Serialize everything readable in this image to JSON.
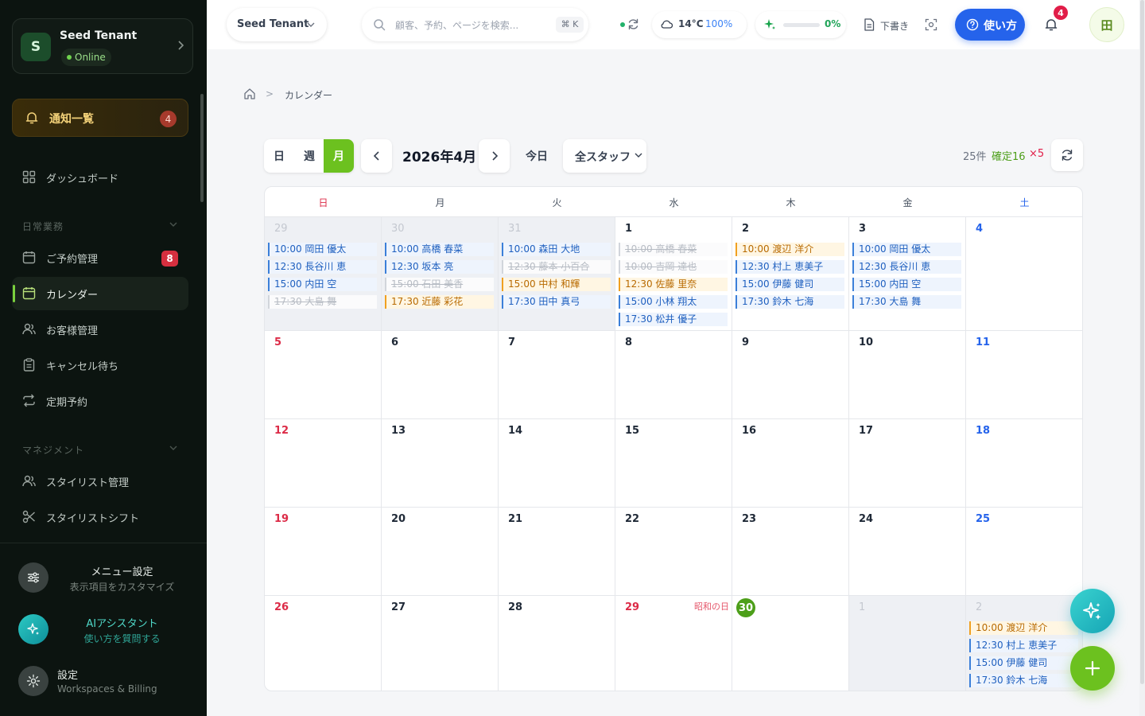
{
  "sidebar": {
    "tenant": {
      "initial": "S",
      "name": "Seed Tenant",
      "status": "Online"
    },
    "notifications": {
      "label": "通知一覧",
      "count": "4"
    },
    "items": [
      {
        "label": "ダッシュボード",
        "icon": "dashboard-icon"
      },
      {
        "label": "ご予約管理",
        "icon": "calendar-icon",
        "badge": "8"
      },
      {
        "label": "カレンダー",
        "icon": "calendar-icon",
        "active": true
      },
      {
        "label": "お客様管理",
        "icon": "users-icon"
      },
      {
        "label": "キャンセル待ち",
        "icon": "clipboard-icon"
      },
      {
        "label": "定期予約",
        "icon": "repeat-icon"
      },
      {
        "label": "スタイリスト管理",
        "icon": "users-icon"
      },
      {
        "label": "スタイリストシフト",
        "icon": "scissors-icon"
      }
    ],
    "sections": [
      "日常業務",
      "マネジメント"
    ],
    "bottom": [
      {
        "title": "メニュー設定",
        "subtitle": "表示項目をカスタマイズ"
      },
      {
        "title": "AIアシスタント",
        "subtitle": "使い方を質問する"
      },
      {
        "title": "設定",
        "subtitle": "Workspaces & Billing"
      }
    ]
  },
  "header": {
    "tenant_select": "Seed Tenant",
    "search_placeholder": "顧客、予約、ページを検索...",
    "search_shortcut": "⌘ K",
    "weather": {
      "temp": "14°C",
      "humidity": "100%"
    },
    "progress": {
      "value": 0,
      "label": "0%"
    },
    "draft_label": "下書き",
    "howto_label": "使い方",
    "notification_count": "4",
    "user_initial": "田"
  },
  "breadcrumb": {
    "current": "カレンダー",
    "separator": ">"
  },
  "toolbar": {
    "views": [
      "日",
      "週",
      "月"
    ],
    "active_view": "月",
    "month_title": "2026年4月",
    "today_label": "今日",
    "staff_filter": "全スタッフ",
    "total_count": "25件",
    "confirmed_count": "確定16",
    "cancel_count": "×5"
  },
  "calendar": {
    "weekdays": [
      "日",
      "月",
      "火",
      "水",
      "木",
      "金",
      "土"
    ],
    "weeks": [
      [
        {
          "day": "29",
          "other": true,
          "events": [
            {
              "text": "10:00 岡田 優太",
              "status": "confirmed"
            },
            {
              "text": "12:30 長谷川 恵",
              "status": "confirmed"
            },
            {
              "text": "15:00 内田 空",
              "status": "confirmed"
            },
            {
              "text": "17:30 大島 舞",
              "status": "cancelled"
            }
          ]
        },
        {
          "day": "30",
          "other": true,
          "events": [
            {
              "text": "10:00 高橋 春菜",
              "status": "confirmed"
            },
            {
              "text": "12:30 坂本 亮",
              "status": "confirmed"
            },
            {
              "text": "15:00 石田 美香",
              "status": "cancelled"
            },
            {
              "text": "17:30 近藤 彩花",
              "status": "pending"
            }
          ]
        },
        {
          "day": "31",
          "other": true,
          "events": [
            {
              "text": "10:00 森田 大地",
              "status": "confirmed"
            },
            {
              "text": "12:30 藤本 小百合",
              "status": "cancelled"
            },
            {
              "text": "15:00 中村 和輝",
              "status": "pending"
            },
            {
              "text": "17:30 田中 真弓",
              "status": "confirmed"
            }
          ]
        },
        {
          "day": "1",
          "events": [
            {
              "text": "10:00 高橋 春菜",
              "status": "cancelled"
            },
            {
              "text": "10:00 吉岡 達也",
              "status": "cancelled"
            },
            {
              "text": "12:30 佐藤 里奈",
              "status": "pending"
            },
            {
              "text": "15:00 小林 翔太",
              "status": "confirmed"
            },
            {
              "text": "17:30 松井 優子",
              "status": "confirmed"
            }
          ]
        },
        {
          "day": "2",
          "events": [
            {
              "text": "10:00 渡辺 洋介",
              "status": "pending"
            },
            {
              "text": "12:30 村上 恵美子",
              "status": "confirmed"
            },
            {
              "text": "15:00 伊藤 健司",
              "status": "confirmed"
            },
            {
              "text": "17:30 鈴木 七海",
              "status": "confirmed"
            }
          ]
        },
        {
          "day": "3",
          "events": [
            {
              "text": "10:00 岡田 優太",
              "status": "confirmed"
            },
            {
              "text": "12:30 長谷川 恵",
              "status": "confirmed"
            },
            {
              "text": "15:00 内田 空",
              "status": "confirmed"
            },
            {
              "text": "17:30 大島 舞",
              "status": "confirmed"
            }
          ]
        },
        {
          "day": "4",
          "events": []
        }
      ],
      [
        {
          "day": "5",
          "events": []
        },
        {
          "day": "6",
          "events": []
        },
        {
          "day": "7",
          "events": []
        },
        {
          "day": "8",
          "events": []
        },
        {
          "day": "9",
          "events": []
        },
        {
          "day": "10",
          "events": []
        },
        {
          "day": "11",
          "events": []
        }
      ],
      [
        {
          "day": "12",
          "events": []
        },
        {
          "day": "13",
          "events": []
        },
        {
          "day": "14",
          "events": []
        },
        {
          "day": "15",
          "events": []
        },
        {
          "day": "16",
          "events": []
        },
        {
          "day": "17",
          "events": []
        },
        {
          "day": "18",
          "events": []
        }
      ],
      [
        {
          "day": "19",
          "events": []
        },
        {
          "day": "20",
          "events": []
        },
        {
          "day": "21",
          "events": []
        },
        {
          "day": "22",
          "events": []
        },
        {
          "day": "23",
          "events": []
        },
        {
          "day": "24",
          "events": []
        },
        {
          "day": "25",
          "events": []
        }
      ],
      [
        {
          "day": "26",
          "events": []
        },
        {
          "day": "27",
          "events": []
        },
        {
          "day": "28",
          "events": []
        },
        {
          "day": "29",
          "holiday": "昭和の日",
          "events": []
        },
        {
          "day": "30",
          "today": true,
          "events": []
        },
        {
          "day": "1",
          "other": true,
          "events": []
        },
        {
          "day": "2",
          "other": true,
          "events": [
            {
              "text": "10:00 渡辺 洋介",
              "status": "pending"
            },
            {
              "text": "12:30 村上 恵美子",
              "status": "confirmed"
            },
            {
              "text": "15:00 伊藤 健司",
              "status": "confirmed"
            },
            {
              "text": "17:30 鈴木 七海",
              "status": "confirmed"
            }
          ]
        }
      ]
    ]
  },
  "colors": {
    "accent": "#6cc11f",
    "primary": "#2563eb",
    "danger": "#e11d48",
    "confirmed": "#3b7fd9",
    "pending": "#f0a020"
  }
}
